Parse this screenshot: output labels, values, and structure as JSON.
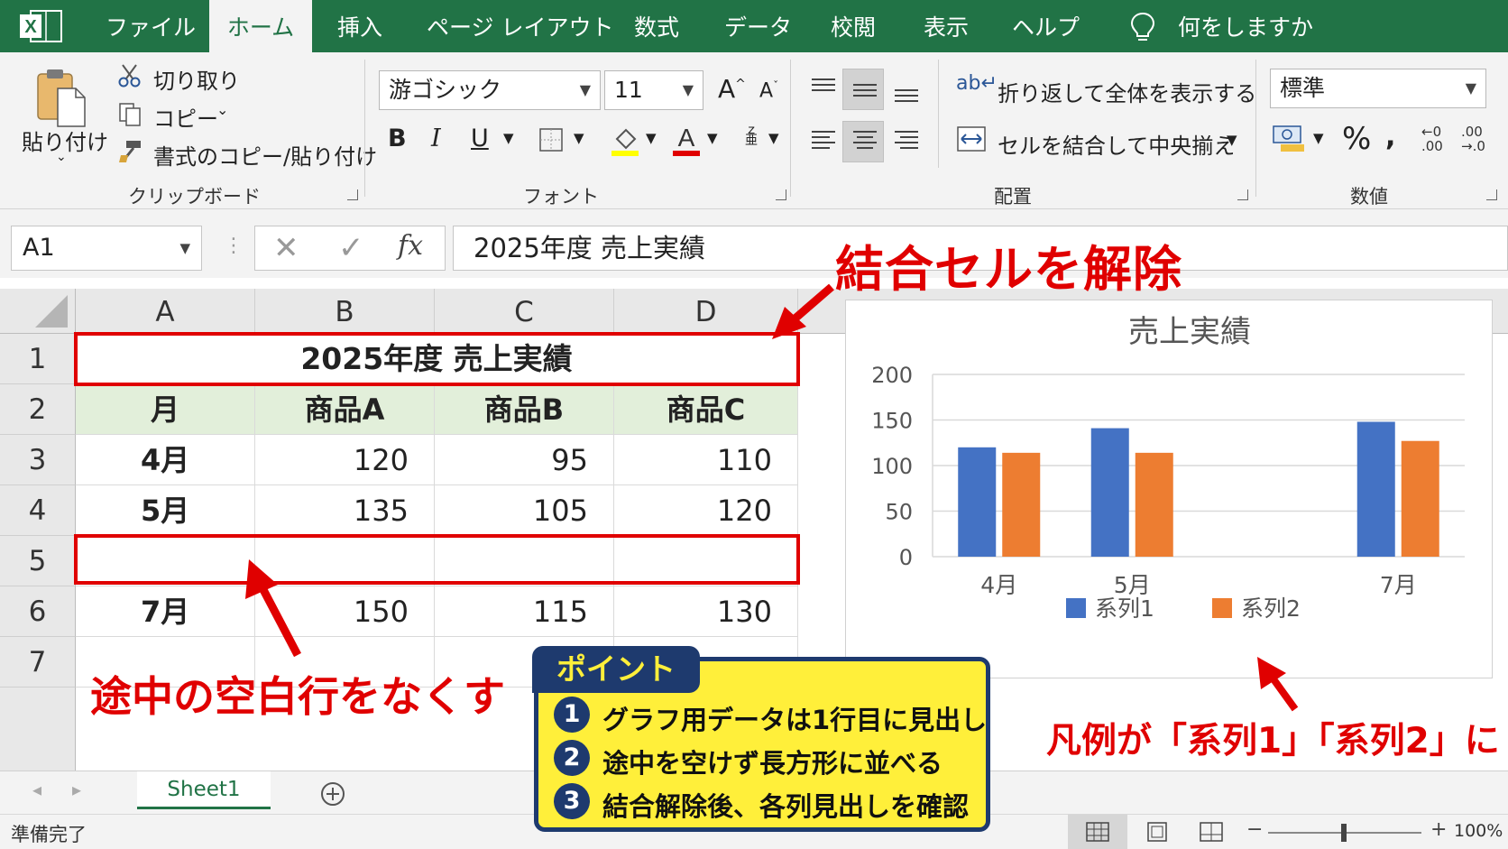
{
  "tabs": [
    "ファイル",
    "ホーム",
    "挿入",
    "ページ レイアウト",
    "数式",
    "データ",
    "校閲",
    "表示",
    "ヘルプ"
  ],
  "tell_me": "何をしますか",
  "ribbon": {
    "paste": "貼り付け",
    "cut": "切り取り",
    "copy": "コピー",
    "format_painter": "書式のコピー/貼り付け",
    "clipboard_group": "クリップボード",
    "font_name": "游ゴシック",
    "font_size": "11",
    "font_group": "フォント",
    "wrap_text": "折り返して全体を表示する",
    "merge_center": "セルを結合して中央揃え",
    "alignment_group": "配置",
    "number_format": "標準",
    "number_group": "数値"
  },
  "formula_bar": {
    "name_box": "A1",
    "fx": "fx",
    "content": "2025年度 売上実績"
  },
  "columns": [
    "A",
    "B",
    "C",
    "D"
  ],
  "rows": [
    "1",
    "2",
    "3",
    "4",
    "5",
    "6",
    "7"
  ],
  "sheet": {
    "title": "2025年度 売上実績",
    "headers": [
      "月",
      "商品A",
      "商品B",
      "商品C"
    ],
    "data": [
      [
        "4月",
        "120",
        "95",
        "110"
      ],
      [
        "5月",
        "135",
        "105",
        "120"
      ],
      [
        "",
        "",
        "",
        ""
      ],
      [
        "7月",
        "150",
        "115",
        "130"
      ]
    ]
  },
  "chart_data": {
    "type": "bar",
    "title": "売上実績",
    "categories": [
      "4月",
      "5月",
      "",
      "7月"
    ],
    "series": [
      {
        "name": "系列1",
        "values": [
          120,
          141,
          0,
          148
        ]
      },
      {
        "name": "系列2",
        "values": [
          114,
          114,
          0,
          127
        ]
      }
    ],
    "ylim": [
      0,
      200
    ],
    "yticks": [
      "0",
      "50",
      "100",
      "150",
      "200"
    ],
    "grid": true,
    "legend": "bottom",
    "colors": [
      "#4472c4",
      "#ed7d31"
    ]
  },
  "annotations": {
    "unmerge": "結合セルを解除",
    "remove_blank": "途中の空白行をなくす",
    "legend_note": "凡例が「系列1」「系列2」に"
  },
  "point": {
    "title": "ポイント",
    "items": [
      {
        "num": "1",
        "text": "グラフ用データは1行目に見出し"
      },
      {
        "num": "2",
        "text": "途中を空けず長方形に並べる"
      },
      {
        "num": "3",
        "text": "結合解除後、各列見出しを確認"
      }
    ]
  },
  "sheet_tab": "Sheet1",
  "status": {
    "ready": "準備完了",
    "zoom": "100%"
  },
  "colors": {
    "excel_green": "#217346",
    "header_fill": "#e2efda",
    "annotation_red": "#e00000",
    "point_fill": "#ffef3a",
    "point_navy": "#1e3a6e"
  }
}
